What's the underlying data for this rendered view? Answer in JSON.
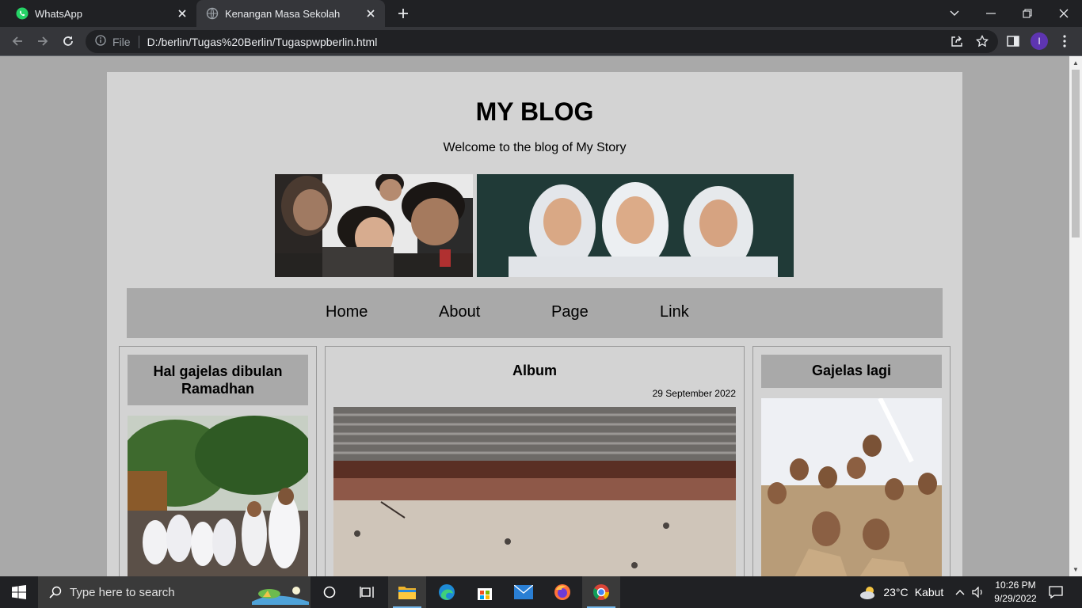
{
  "browser": {
    "tabs": [
      {
        "title": "WhatsApp"
      },
      {
        "title": "Kenangan Masa Sekolah"
      }
    ],
    "address_label": "File",
    "url": "D:/berlin/Tugas%20Berlin/Tugaspwpberlin.html",
    "profile_initial": "I"
  },
  "page": {
    "title": "MY BLOG",
    "subtitle": "Welcome to the blog of My Story",
    "nav": [
      "Home",
      "About",
      "Page",
      "Link"
    ],
    "left_card": {
      "title": "Hal gajelas dibulan Ramadhan"
    },
    "center_card": {
      "title": "Album",
      "date": "29 September 2022"
    },
    "right_card": {
      "title": "Gajelas lagi"
    }
  },
  "taskbar": {
    "search_placeholder": "Type here to search",
    "weather": "23°C",
    "weather_desc": "Kabut",
    "time": "10:26 PM",
    "date": "9/29/2022"
  },
  "colors": {
    "page_bg": "#d3d3d3",
    "outer_bg": "#a9a9a9",
    "nav_bg": "#a9a9a9",
    "chrome_dark": "#202124"
  }
}
